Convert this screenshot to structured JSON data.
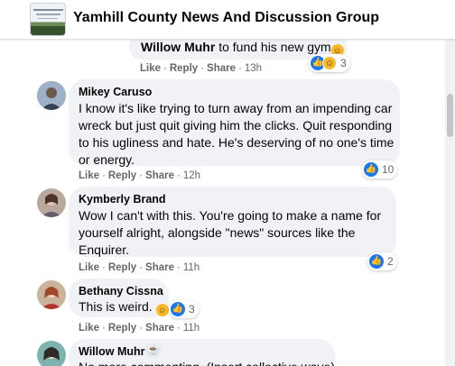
{
  "header": {
    "group_name": "Yamhill County News And Discussion Group"
  },
  "actions": {
    "like": "Like",
    "reply": "Reply",
    "share": "Share",
    "sep": "·"
  },
  "comments": [
    {
      "author": "Willow Muhr",
      "text": "to fund his new gym",
      "time": "13h",
      "reactions": {
        "icons": [
          "like-icon",
          "haha-icon"
        ],
        "count": "3"
      }
    },
    {
      "author": "Mikey Caruso",
      "lines": [
        "I know it's like trying to turn away from an impending car",
        "wreck but just quit giving him the clicks. Quit responding",
        "to his ugliness and hate. He's deserving of no one's time",
        "or energy."
      ],
      "time": "12h",
      "reactions": {
        "icons": [
          "like-icon"
        ],
        "count": "10"
      }
    },
    {
      "author": "Kymberly Brand",
      "lines": [
        "Wow I can't with this. You're going to make a name for",
        "yourself alright, alongside \"news\" sources like the",
        "Enquirer."
      ],
      "time": "11h",
      "reactions": {
        "icons": [
          "like-icon"
        ],
        "count": "2"
      }
    },
    {
      "author": "Bethany Cissna",
      "text": "This is weird.",
      "time": "11h",
      "reactions": {
        "icons": [
          "like-icon"
        ],
        "count": "3"
      }
    },
    {
      "author": "Willow Muhr",
      "badge_icon": "coffee-mug-icon",
      "partial_text": "No more commenting. (Insert collective wave)"
    }
  ],
  "colors": {
    "accent": "#1877f2",
    "bubble": "#f0f2f5",
    "meta": "#65676b"
  }
}
